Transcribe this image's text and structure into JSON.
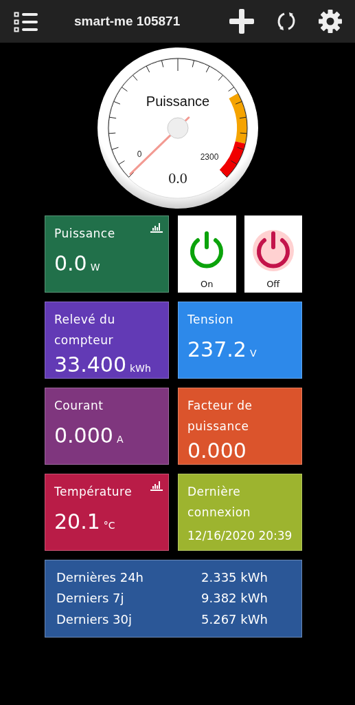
{
  "header": {
    "title": "smart-me 105871"
  },
  "gauge": {
    "title": "Puissance",
    "min_label": "0",
    "max_label": "2300",
    "reading": "0.0"
  },
  "tiles": [
    {
      "kind": "metric",
      "title": "Puissance",
      "value": "0.0",
      "unit": "W",
      "color": "#21704a",
      "chart_icon": true
    },
    {
      "kind": "switches",
      "buttons": [
        {
          "label": "On",
          "kind": "on",
          "selected": false
        },
        {
          "label": "Off",
          "kind": "off",
          "selected": true
        }
      ]
    },
    {
      "kind": "metric",
      "title": "Relevé du compteur",
      "value": "33.400",
      "unit": "kWh",
      "color": "#623ab5",
      "chart_icon": false
    },
    {
      "kind": "metric",
      "title": "Tension",
      "value": "237.2",
      "unit": "V",
      "color": "#2d89ea",
      "chart_icon": false
    },
    {
      "kind": "metric",
      "title": "Courant",
      "value": "0.000",
      "unit": "A",
      "color": "#7f367e",
      "chart_icon": false
    },
    {
      "kind": "metric",
      "title": "Facteur de puissance",
      "value": "0.000",
      "color": "#db542c",
      "chart_icon": false
    },
    {
      "kind": "metric",
      "title": "Température",
      "value": "20.1",
      "unit": "°C",
      "color": "#b91c47",
      "chart_icon": true
    },
    {
      "kind": "timestamp",
      "title": "Dernière connexion",
      "value": "12/16/2020 20:39",
      "color": "#9db42f",
      "chart_icon": false
    }
  ],
  "summary": [
    {
      "label": "Dernières 24h",
      "value": "2.335 kWh"
    },
    {
      "label": "Derniers 7j",
      "value": "9.382 kWh"
    },
    {
      "label": "Derniers 30j",
      "value": "5.267 kWh"
    }
  ]
}
